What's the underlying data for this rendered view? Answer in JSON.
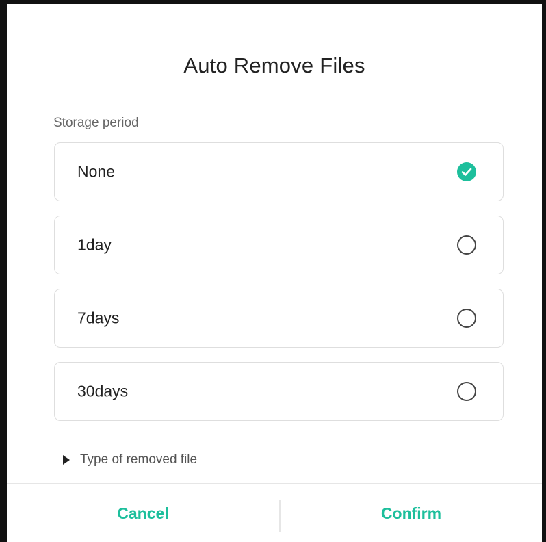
{
  "dialog": {
    "title": "Auto Remove Files",
    "section_label": "Storage period",
    "accent_color": "#1dbf9c",
    "options": [
      {
        "label": "None",
        "selected": true
      },
      {
        "label": "1day",
        "selected": false
      },
      {
        "label": "7days",
        "selected": false
      },
      {
        "label": "30days",
        "selected": false
      }
    ],
    "disclosure": {
      "icon": "triangle-right-icon",
      "label": "Type of removed file"
    },
    "footer": {
      "cancel_label": "Cancel",
      "confirm_label": "Confirm"
    }
  }
}
